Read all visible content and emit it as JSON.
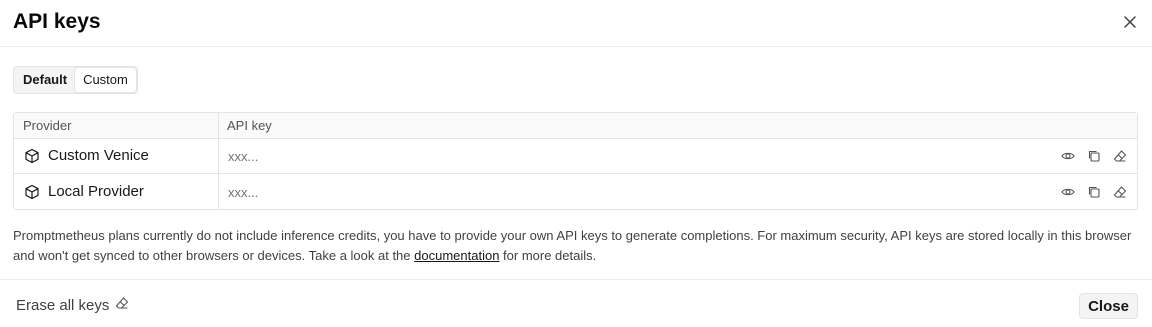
{
  "dialog": {
    "title": "API keys",
    "close_icon": "close-icon"
  },
  "tabs": [
    {
      "label": "Default",
      "active": false
    },
    {
      "label": "Custom",
      "active": true
    }
  ],
  "table": {
    "columns": [
      "Provider",
      "API key"
    ],
    "rows": [
      {
        "icon": "cube-icon",
        "provider": "Custom Venice",
        "api_key_value": "",
        "api_key_placeholder": "xxx..."
      },
      {
        "icon": "cube-icon",
        "provider": "Local Provider",
        "api_key_value": "",
        "api_key_placeholder": "xxx..."
      }
    ],
    "row_actions": [
      "eye-icon",
      "copy-icon",
      "eraser-icon"
    ]
  },
  "note": {
    "before_link": "Promptmetheus plans currently do not include inference credits, you have to provide your own API keys to generate completions. For maximum security, API keys are stored locally in this browser and won't get synced to other browsers or devices. Take a look at the ",
    "link": "documentation",
    "after_link": " for more details."
  },
  "footer": {
    "erase_all_label": "Erase all keys",
    "close_label": "Close"
  }
}
